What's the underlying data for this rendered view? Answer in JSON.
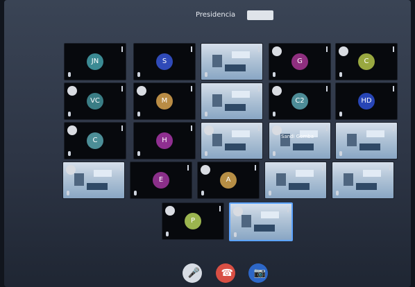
{
  "header": {
    "title": "Presidencia"
  },
  "controls": {
    "mic": "mic-icon",
    "leave": "phone-icon",
    "camera": "camera-icon"
  },
  "tiles": [
    {
      "id": "jn",
      "kind": "avatar",
      "initials": "JN",
      "color": "#3b8a93"
    },
    {
      "id": "s",
      "kind": "avatar",
      "initials": "S",
      "color": "#2f4ab8"
    },
    {
      "id": "v1",
      "kind": "video"
    },
    {
      "id": "g",
      "kind": "avatar",
      "initials": "G",
      "color": "#8f2f7f"
    },
    {
      "id": "c",
      "kind": "avatar",
      "initials": "C",
      "color": "#99a840"
    },
    {
      "id": "vc",
      "kind": "avatar",
      "initials": "VC",
      "color": "#3a7d85"
    },
    {
      "id": "m",
      "kind": "avatar",
      "initials": "M",
      "color": "#b98c45"
    },
    {
      "id": "v2",
      "kind": "video"
    },
    {
      "id": "c2",
      "kind": "avatar",
      "initials": "C2",
      "color": "#4d8c97"
    },
    {
      "id": "hd",
      "kind": "avatar",
      "initials": "HD",
      "color": "#2745b6"
    },
    {
      "id": "c3",
      "kind": "avatar",
      "initials": "C",
      "color": "#4c8e97"
    },
    {
      "id": "h",
      "kind": "avatar",
      "initials": "H",
      "color": "#8f2f90"
    },
    {
      "id": "v3",
      "kind": "video"
    },
    {
      "id": "v4",
      "kind": "video",
      "label": "Sandi Gomba"
    },
    {
      "id": "v5",
      "kind": "video"
    },
    {
      "id": "v6",
      "kind": "video"
    },
    {
      "id": "e",
      "kind": "avatar",
      "initials": "E",
      "color": "#8a2f89"
    },
    {
      "id": "a",
      "kind": "avatar",
      "initials": "A",
      "color": "#b68e45"
    },
    {
      "id": "v7",
      "kind": "video"
    },
    {
      "id": "v8",
      "kind": "video"
    },
    {
      "id": "p",
      "kind": "avatar",
      "initials": "P",
      "color": "#9bb54f"
    },
    {
      "id": "v9",
      "kind": "video",
      "active": true
    }
  ]
}
